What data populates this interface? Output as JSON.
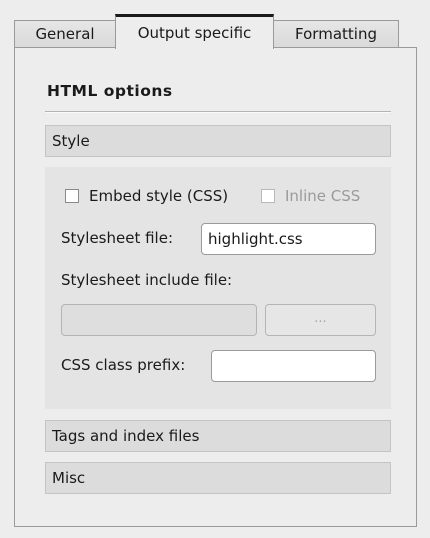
{
  "tabs": [
    {
      "label": "General",
      "active": false
    },
    {
      "label": "Output specific",
      "active": true
    },
    {
      "label": "Formatting",
      "active": false
    }
  ],
  "section_title": "HTML options",
  "groups": {
    "style": {
      "header": "Style",
      "embed_style_label": "Embed style (CSS)",
      "embed_style_checked": false,
      "inline_css_label": "Inline CSS",
      "inline_css_checked": false,
      "stylesheet_file_label": "Stylesheet file:",
      "stylesheet_file_value": "highlight.css",
      "stylesheet_include_label": "Stylesheet include file:",
      "stylesheet_include_value": "",
      "browse_button_label": "...",
      "css_prefix_label": "CSS class prefix:",
      "css_prefix_value": ""
    },
    "tags_header": "Tags and index files",
    "misc_header": "Misc"
  },
  "colors": {
    "window_bg": "#ededed",
    "header_bg": "#dcdcdc",
    "disabled_text": "#9a9a9a"
  }
}
